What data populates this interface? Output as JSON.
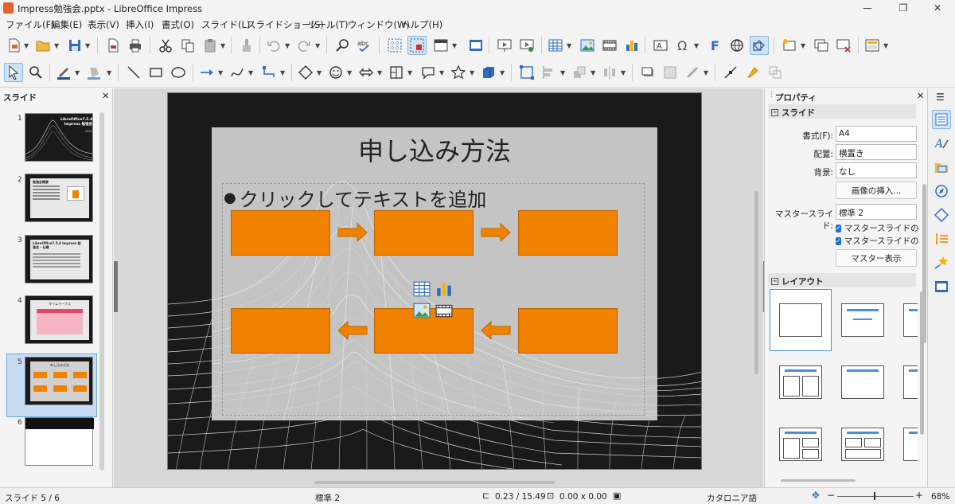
{
  "window": {
    "title": "Impress勉強会.pptx - LibreOffice Impress",
    "minimize": "—",
    "maximize": "❐",
    "close": "✕"
  },
  "menu": [
    {
      "label": "ファイル(F)"
    },
    {
      "label": "編集(E)"
    },
    {
      "label": "表示(V)"
    },
    {
      "label": "挿入(I)"
    },
    {
      "label": "書式(O)"
    },
    {
      "label": "スライド(L)"
    },
    {
      "label": "スライドショー(S)"
    },
    {
      "label": "ツール(T)"
    },
    {
      "label": "ウィンドウ(W)"
    },
    {
      "label": "ヘルプ(H)"
    }
  ],
  "slides_panel": {
    "title": "スライド",
    "close": "✕",
    "slides": [
      {
        "num": "1",
        "title": "LibreOffice7.5.4 Impress 勉強会",
        "sub": "2023"
      },
      {
        "num": "2",
        "title": "勉強会概要"
      },
      {
        "num": "3",
        "title": "LibreOffice7.5.4 Impress 勉強会 - 仕様"
      },
      {
        "num": "4",
        "title": "タイムテーブル"
      },
      {
        "num": "5",
        "title": "申し込み方法"
      },
      {
        "num": "6",
        "title": ""
      }
    ]
  },
  "slide": {
    "title": "申し込み方法",
    "bullet": "●",
    "body_placeholder": "クリックしてテキストを追加"
  },
  "properties": {
    "title": "プロパティ",
    "close": "✕",
    "slide_section": "スライド",
    "format_label": "書式(F):",
    "format_value": "A4",
    "orientation_label": "配置:",
    "orientation_value": "横置き",
    "background_label": "背景:",
    "background_value": "なし",
    "insert_image": "画像の挿入...",
    "master_label": "マスタースライド:",
    "master_value": "標準 2",
    "master_bg": "マスタースライドの背景",
    "master_objects": "マスタースライドのオブジェクト",
    "master_view": "マスター表示",
    "layout_section": "レイアウト"
  },
  "status": {
    "slide": "スライド 5 / 6",
    "master": "標準 2",
    "position": "0.23 / 15.49",
    "size": "0.00 x 0.00",
    "language": "カタロニア語",
    "zoom": "68%",
    "zoom_minus": "−",
    "zoom_plus": "+"
  },
  "colors": {
    "accent": "#f08200",
    "selection": "#1f6fd1"
  }
}
